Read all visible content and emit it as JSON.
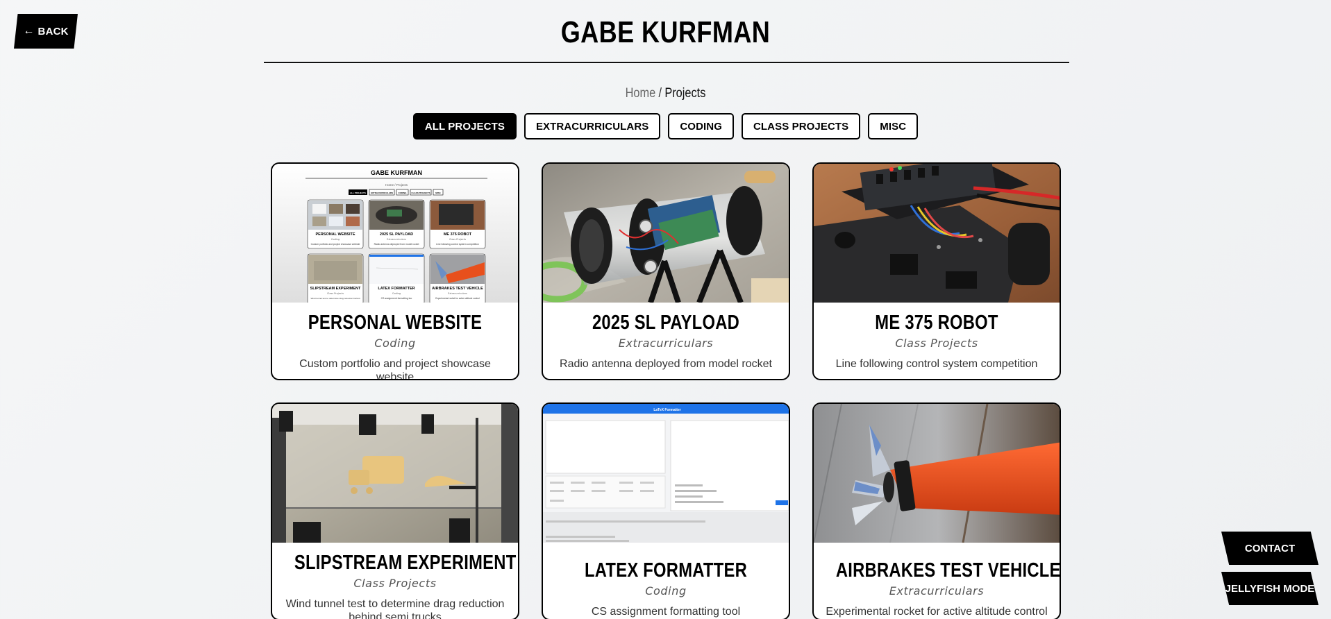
{
  "nav": {
    "back_arrow": "←",
    "back_label": "BACK"
  },
  "header": {
    "title": "GABE KURFMAN"
  },
  "breadcrumb": {
    "home": "Home",
    "separator": "/",
    "current": "Projects"
  },
  "filters": [
    {
      "label": "ALL PROJECTS",
      "active": true
    },
    {
      "label": "EXTRACURRICULARS",
      "active": false
    },
    {
      "label": "CODING",
      "active": false
    },
    {
      "label": "CLASS PROJECTS",
      "active": false
    },
    {
      "label": "MISC",
      "active": false
    }
  ],
  "projects": [
    {
      "title": "PERSONAL WEBSITE",
      "category": "Coding",
      "description": "Custom portfolio and project showcase website"
    },
    {
      "title": "2025 SL PAYLOAD",
      "category": "Extracurriculars",
      "description": "Radio antenna deployed from model rocket"
    },
    {
      "title": "ME 375 ROBOT",
      "category": "Class Projects",
      "description": "Line following control system competition"
    },
    {
      "title": "SLIPSTREAM EXPERIMENT",
      "category": "Class Projects",
      "description": "Wind tunnel test to determine drag reduction behind semi trucks"
    },
    {
      "title": "LATEX FORMATTER",
      "category": "Coding",
      "description": "CS assignment formatting tool"
    },
    {
      "title": "AIRBRAKES TEST VEHICLE",
      "category": "Extracurriculars",
      "description": "Experimental rocket for active altitude control"
    }
  ],
  "thumbnails": {
    "website_preview": {
      "title": "GABE KURFMAN",
      "breadcrumb": "Home / Projects",
      "tabs": [
        "ALL PROJECTS",
        "EXTRACURRICULARS",
        "CODING",
        "CLASS PROJECTS",
        "MISC"
      ],
      "cards": [
        {
          "title": "PERSONAL WEBSITE",
          "category": "Coding",
          "description": "Custom portfolio and project showcase website"
        },
        {
          "title": "2025 SL PAYLOAD",
          "category": "Extracurriculars",
          "description": "Radio antenna deployed from model rocket"
        },
        {
          "title": "ME 375 ROBOT",
          "category": "Class Projects",
          "description": "Line following control system competition"
        },
        {
          "title": "SLIPSTREAM EXPERIMENT",
          "category": "Class Projects",
          "description": "Wind tunnel test to determine drag reduction behind"
        },
        {
          "title": "LATEX FORMATTER",
          "category": "Coding",
          "description": "CS assignment formatting too"
        },
        {
          "title": "AIRBRAKES TEST VEHICLE",
          "category": "Extracurriculars",
          "description": "Experimental rocket for active altitude control"
        }
      ]
    },
    "latex_preview": {
      "header": "LaTeX Formatter"
    }
  },
  "floating": {
    "contact": "CONTACT",
    "jellyfish": "JELLYFISH MODE"
  },
  "colors": {
    "background": "#f2f3f5",
    "ink": "#000000",
    "accent_blue": "#1e73e8",
    "rocket_orange": "#e8501c"
  }
}
